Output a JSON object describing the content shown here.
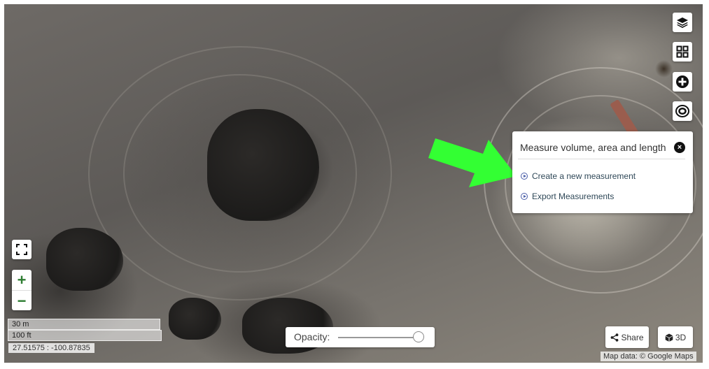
{
  "map": {
    "scale_metric": "30 m",
    "scale_imperial": "100 ft",
    "coordinates": "27.51575 : -100.87835",
    "attribution": "Map data: © Google Maps"
  },
  "toolbar": {
    "icons": [
      "layers-icon",
      "grid-icon",
      "plus-circle-icon",
      "ring-icon"
    ]
  },
  "zoom": {
    "in_label": "+",
    "out_label": "−"
  },
  "measure_panel": {
    "title": "Measure volume, area and length",
    "close_label": "×",
    "items": [
      {
        "label": "Create a new measurement"
      },
      {
        "label": "Export Measurements"
      }
    ]
  },
  "opacity": {
    "label": "Opacity:",
    "value": 1.0
  },
  "share_button": {
    "label": "Share"
  },
  "three_d_button": {
    "label": "3D"
  },
  "colors": {
    "accent_green": "#2e7d32",
    "annotation_arrow": "#33ff33",
    "link_color": "#2f4858"
  }
}
